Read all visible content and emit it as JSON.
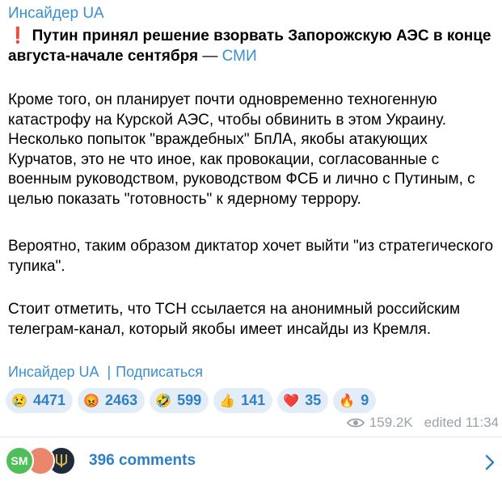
{
  "post": {
    "channel_name": "Инсайдер UA",
    "headline_mark": "❗",
    "headline": "Путин принял решение взорвать Запорожскую АЭС в конце августа-начале сентября",
    "headline_dash": " — ",
    "headline_source": "СМИ",
    "paragraphs": [
      "Кроме того, он планирует почти одновременно техногенную катастрофу на Курской АЭС, чтобы обвинить в этом Украину. Несколько попыток \"враждебных\" БпЛА, якобы атакующих Курчатов, это не что иное, как провокации, согласованные с военным руководством, руководством ФСБ и лично с Путиным, с целью показать \"готовность\" к ядерному террору.",
      "Вероятно, таким образом диктатор хочет выйти \"из стратегического тупика\".",
      "Стоит отметить, что ТСН ссылается на анонимный российским телеграм-канал, который якобы имеет инсайды из Кремля."
    ],
    "footer_channel_link": "Инсайдер UA",
    "footer_separator": "|",
    "footer_subscribe_link": "Подписаться"
  },
  "reactions": [
    {
      "icon": "crying-face-icon",
      "emoji": "😢",
      "count": "4471"
    },
    {
      "icon": "angry-face-icon",
      "emoji": "😡",
      "count": "2463"
    },
    {
      "icon": "rofl-face-icon",
      "emoji": "🤣",
      "count": "599"
    },
    {
      "icon": "thumbs-up-icon",
      "emoji": "👍",
      "count": "141"
    },
    {
      "icon": "red-heart-icon",
      "emoji": "❤️",
      "count": "35"
    },
    {
      "icon": "fire-icon",
      "emoji": "🔥",
      "count": "9"
    }
  ],
  "meta": {
    "views": "159.2K",
    "edited": "edited 11:34"
  },
  "comments": {
    "avatar_initials": "SM",
    "label": "396 comments"
  },
  "colors": {
    "link": "#3a8fd1",
    "reaction_bg": "#e3edf8",
    "reaction_text": "#2f7fc6",
    "meta_text": "#9aa3ab",
    "accent_red": "#e53935"
  }
}
